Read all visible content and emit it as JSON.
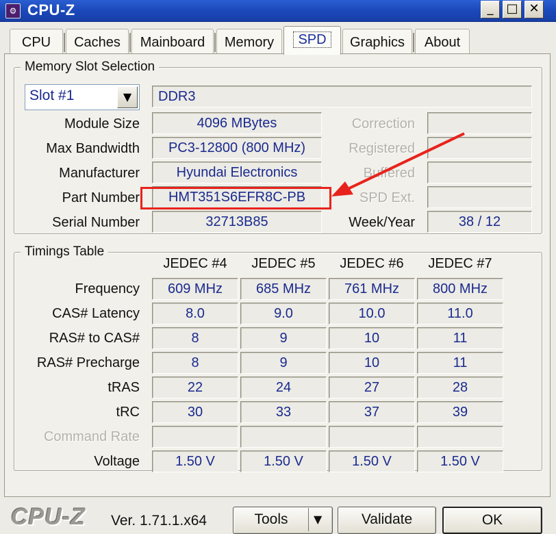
{
  "window": {
    "title": "CPU-Z",
    "icon": "cpuz-app-icon",
    "minimize": "_",
    "maximize": "□",
    "close": "✕"
  },
  "tabs": [
    {
      "label": "CPU"
    },
    {
      "label": "Caches"
    },
    {
      "label": "Mainboard"
    },
    {
      "label": "Memory"
    },
    {
      "label": "SPD",
      "active": true
    },
    {
      "label": "Graphics"
    },
    {
      "label": "About"
    }
  ],
  "memory_slot": {
    "group_title": "Memory Slot Selection",
    "slot_selected": "Slot #1",
    "dropdown_arrow": "▼",
    "memory_type": "DDR3",
    "labels": {
      "module_size": "Module Size",
      "max_bandwidth": "Max Bandwidth",
      "manufacturer": "Manufacturer",
      "part_number": "Part Number",
      "serial_number": "Serial Number",
      "correction": "Correction",
      "registered": "Registered",
      "buffered": "Buffered",
      "spd_ext": "SPD Ext.",
      "week_year": "Week/Year"
    },
    "values": {
      "module_size": "4096 MBytes",
      "max_bandwidth": "PC3-12800 (800 MHz)",
      "manufacturer": "Hyundai Electronics",
      "part_number": "HMT351S6EFR8C-PB",
      "serial_number": "32713B85",
      "correction": "",
      "registered": "",
      "buffered": "",
      "spd_ext": "",
      "week_year": "38 / 12"
    }
  },
  "timings": {
    "group_title": "Timings Table",
    "columns": [
      "JEDEC #4",
      "JEDEC #5",
      "JEDEC #6",
      "JEDEC #7"
    ],
    "rows": [
      {
        "label": "Frequency",
        "values": [
          "609 MHz",
          "685 MHz",
          "761 MHz",
          "800 MHz"
        ],
        "enabled": true
      },
      {
        "label": "CAS# Latency",
        "values": [
          "8.0",
          "9.0",
          "10.0",
          "11.0"
        ],
        "enabled": true
      },
      {
        "label": "RAS# to CAS#",
        "values": [
          "8",
          "9",
          "10",
          "11"
        ],
        "enabled": true
      },
      {
        "label": "RAS# Precharge",
        "values": [
          "8",
          "9",
          "10",
          "11"
        ],
        "enabled": true
      },
      {
        "label": "tRAS",
        "values": [
          "22",
          "24",
          "27",
          "28"
        ],
        "enabled": true
      },
      {
        "label": "tRC",
        "values": [
          "30",
          "33",
          "37",
          "39"
        ],
        "enabled": true
      },
      {
        "label": "Command Rate",
        "values": [
          "",
          "",
          "",
          ""
        ],
        "enabled": false
      },
      {
        "label": "Voltage",
        "values": [
          "1.50 V",
          "1.50 V",
          "1.50 V",
          "1.50 V"
        ],
        "enabled": true
      }
    ]
  },
  "footer": {
    "logo": "CPU-Z",
    "version": "Ver. 1.71.1.x64",
    "tools_label": "Tools",
    "tools_arrow": "▼",
    "validate_label": "Validate",
    "ok_label": "OK"
  },
  "colors": {
    "value_text": "#1a2a8f",
    "annotation_red": "#e8231d",
    "titlebar": "#1a47b8"
  }
}
